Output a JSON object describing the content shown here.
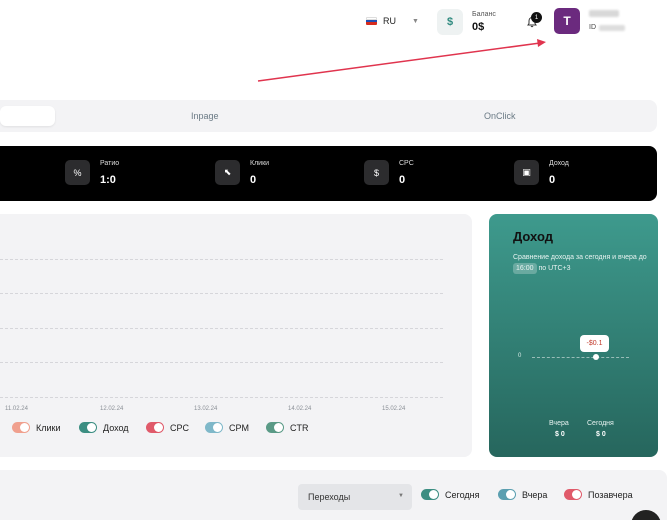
{
  "header": {
    "language": "RU",
    "balance_label": "Баланс",
    "balance_value": "0$",
    "balance_icon": "dollar-icon",
    "notification_count": "1",
    "avatar_letter": "T",
    "user_id_label": "ID"
  },
  "tabs": [
    {
      "label": "",
      "active": true
    },
    {
      "label": "Inpage",
      "active": false
    },
    {
      "label": "OnClick",
      "active": false
    }
  ],
  "stats": [
    {
      "icon": "percent-icon",
      "glyph": "%",
      "label": "Ратио",
      "value": "1:0"
    },
    {
      "icon": "cursor-icon",
      "glyph": "⬉",
      "label": "Клики",
      "value": "0"
    },
    {
      "icon": "dollar-icon",
      "glyph": "$",
      "label": "CPC",
      "value": "0"
    },
    {
      "icon": "wallet-icon",
      "glyph": "▣",
      "label": "Доход",
      "value": "0"
    }
  ],
  "chart": {
    "dates": [
      "11.02.24",
      "12.02.24",
      "13.02.24",
      "14.02.24",
      "15.02.24"
    ],
    "legend": [
      {
        "label": "Клики",
        "color": "#f0a08e"
      },
      {
        "label": "Доход",
        "color": "#3c8e82"
      },
      {
        "label": "CPC",
        "color": "#e05a6a"
      },
      {
        "label": "CPM",
        "color": "#7fb8c9"
      },
      {
        "label": "CTR",
        "color": "#5a9a86"
      }
    ]
  },
  "chart_data": {
    "type": "line",
    "categories": [
      "11.02.24",
      "12.02.24",
      "13.02.24",
      "14.02.24",
      "15.02.24"
    ],
    "series": [
      {
        "name": "Клики",
        "values": []
      },
      {
        "name": "Доход",
        "values": []
      },
      {
        "name": "CPC",
        "values": []
      },
      {
        "name": "CPM",
        "values": []
      },
      {
        "name": "CTR",
        "values": []
      }
    ],
    "grid": true,
    "legend": "bottom"
  },
  "income": {
    "title": "Доход",
    "desc_prefix": "Сравнение дохода за сегодня и вчера до",
    "time": "16:00",
    "desc_suffix": "по UTC+3",
    "axis_zero": "0",
    "tooltip": "-$0.1",
    "yesterday_label": "Вчера",
    "yesterday_value": "$ 0",
    "today_label": "Сегодня",
    "today_value": "$ 0"
  },
  "bottom": {
    "select_value": "Переходы",
    "legend": [
      {
        "label": "Сегодня",
        "color": "#3c8e82"
      },
      {
        "label": "Вчера",
        "color": "#5b9fb0"
      },
      {
        "label": "Позавчера",
        "color": "#e05a6a"
      }
    ]
  },
  "colors": {
    "accent": "#3c8e82",
    "avatar": "#6b2a7e",
    "annotation_arrow": "#e0344e"
  }
}
